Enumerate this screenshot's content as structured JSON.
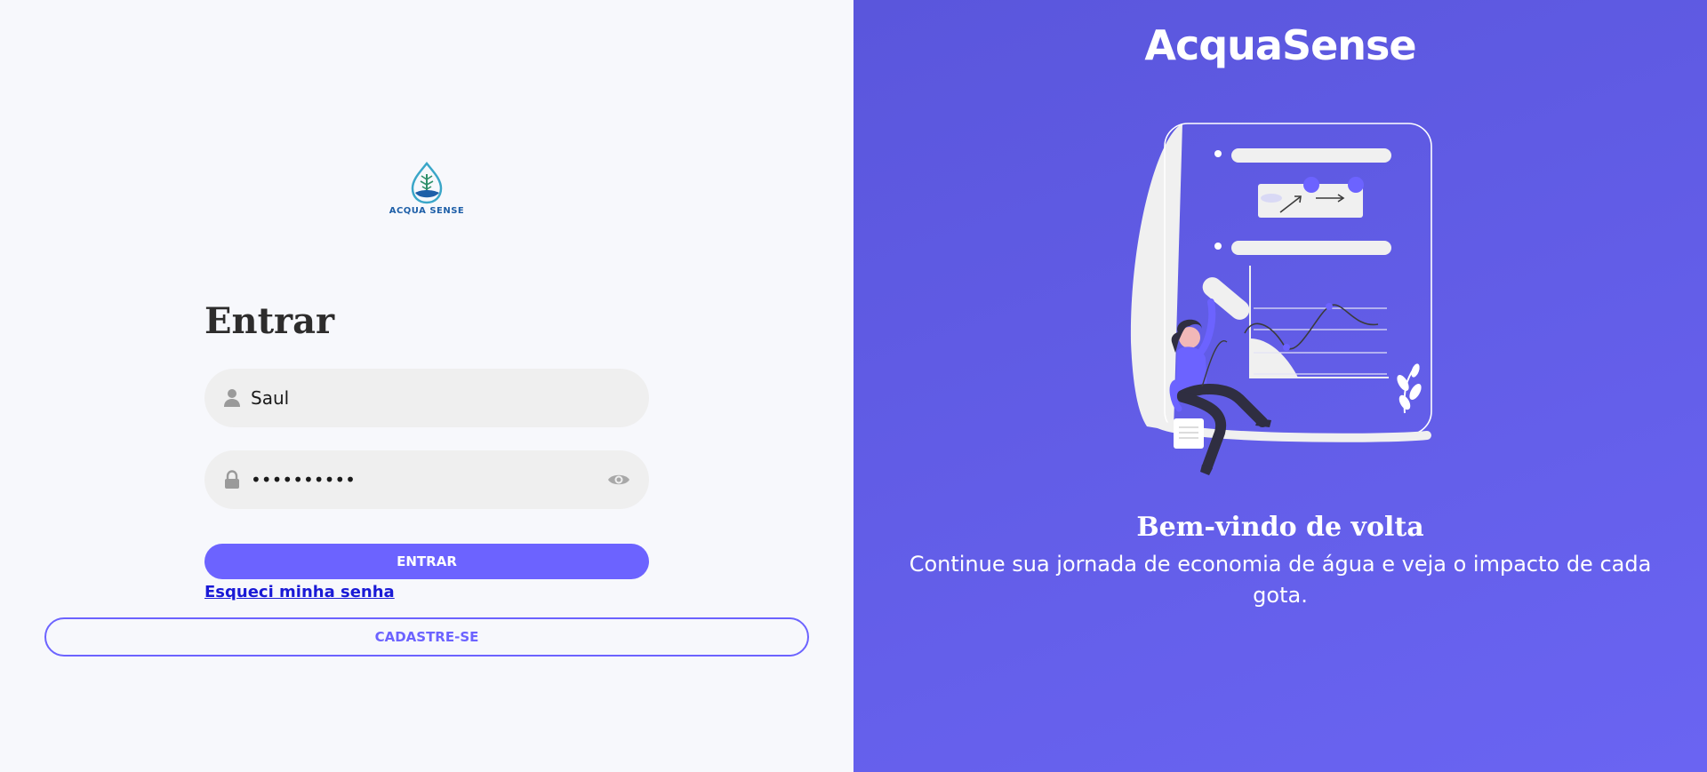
{
  "login": {
    "logo_text": "ACQUA SENSE",
    "heading": "Entrar",
    "username_value": "Saul",
    "password_value": "••••••••••",
    "submit_label": "ENTRAR",
    "forgot_label": "Esqueci minha senha",
    "signup_label": "CADASTRE-SE"
  },
  "promo": {
    "brand": "AcquaSense",
    "title": "Bem-vindo de volta",
    "subtitle": "Continue sua jornada de economia de água e veja o impacto de cada gota."
  },
  "icons": {
    "user": "user-icon",
    "lock": "lock-icon",
    "eye": "eye-icon",
    "logo": "water-drop-plant-logo"
  },
  "colors": {
    "accent": "#6c63ff",
    "left_bg": "#f7f8fc",
    "right_bg": "#5f5ae6",
    "field_bg": "#efefef",
    "link": "#1a1ad6"
  }
}
